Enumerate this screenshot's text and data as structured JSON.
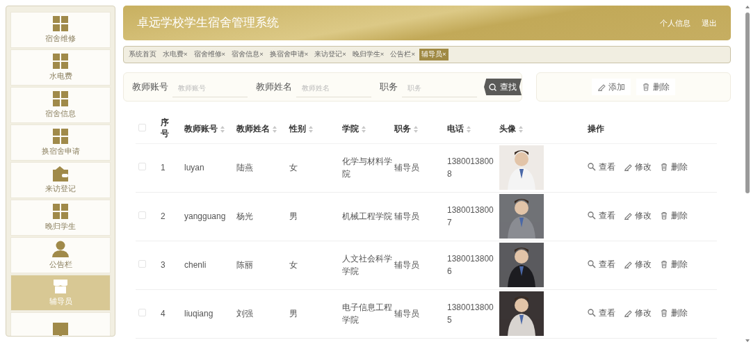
{
  "sidebar": {
    "items": [
      {
        "kind": "grid",
        "label": "宿舍维修",
        "selected": false
      },
      {
        "kind": "grid",
        "label": "水电费",
        "selected": false
      },
      {
        "kind": "grid",
        "label": "宿舍信息",
        "selected": false
      },
      {
        "kind": "grid",
        "label": "换宿舍申请",
        "selected": false
      },
      {
        "kind": "wallet",
        "label": "来访登记",
        "selected": false
      },
      {
        "kind": "grid",
        "label": "晚归学生",
        "selected": false
      },
      {
        "kind": "person",
        "label": "公告栏",
        "selected": false
      },
      {
        "kind": "store",
        "label": "辅导员",
        "selected": true
      },
      {
        "kind": "monitor",
        "selected": false
      }
    ]
  },
  "header": {
    "title": "卓远学校学生宿舍管理系统",
    "links": [
      "个人信息",
      "退出"
    ]
  },
  "tabs": [
    {
      "label": "系统首页",
      "selected": false
    },
    {
      "label": "水电费",
      "close": "×",
      "selected": false
    },
    {
      "label": "宿舍维修",
      "close": "×",
      "selected": false
    },
    {
      "label": "宿舍信息",
      "close": "×",
      "selected": false
    },
    {
      "label": "换宿舍申请",
      "close": "×",
      "selected": false
    },
    {
      "label": "来访登记",
      "close": "×",
      "selected": false
    },
    {
      "label": "晚归学生",
      "close": "×",
      "selected": false
    },
    {
      "label": "公告栏",
      "close": "×",
      "selected": false
    },
    {
      "label": "辅导员",
      "close": "×",
      "selected": true
    }
  ],
  "search": {
    "fields": [
      {
        "label": "教师账号",
        "placeholder": "教师账号"
      },
      {
        "label": "教师姓名",
        "placeholder": "教师姓名"
      },
      {
        "label": "职务",
        "placeholder": "职务"
      }
    ],
    "button": "查找"
  },
  "actions": [
    {
      "kind": "add",
      "label": "添加"
    },
    {
      "kind": "delete",
      "label": "删除"
    }
  ],
  "table": {
    "select_all_checked": false,
    "columns": [
      {
        "label": "序号",
        "sortable": false
      },
      {
        "label": "教师账号",
        "sortable": true
      },
      {
        "label": "教师姓名",
        "sortable": true
      },
      {
        "label": "性别",
        "sortable": true
      },
      {
        "label": "学院",
        "sortable": true
      },
      {
        "label": "职务",
        "sortable": true
      },
      {
        "label": "电话",
        "sortable": true
      },
      {
        "label": "头像",
        "sortable": true
      },
      {
        "label": "操作",
        "sortable": false
      }
    ],
    "rows": [
      {
        "checked": false,
        "cells": [
          "1",
          "luyan",
          "陆燕",
          "女",
          "化学与材料学院",
          "辅导员",
          "13800138008"
        ],
        "avatar": {
          "kind": "picture"
        },
        "operations": [
          {
            "kind": "view",
            "label": "查看"
          },
          {
            "kind": "edit",
            "label": "修改"
          },
          {
            "kind": "delete",
            "label": "删除"
          }
        ]
      },
      {
        "checked": false,
        "cells": [
          "2",
          "yangguang",
          "杨光",
          "男",
          "机械工程学院",
          "辅导员",
          "13800138007"
        ],
        "avatar": {
          "kind": "picture"
        },
        "operations": [
          {
            "kind": "view",
            "label": "查看"
          },
          {
            "kind": "edit",
            "label": "修改"
          },
          {
            "kind": "delete",
            "label": "删除"
          }
        ]
      },
      {
        "checked": false,
        "cells": [
          "3",
          "chenli",
          "陈丽",
          "女",
          "人文社会科学学院",
          "辅导员",
          "13800138006"
        ],
        "avatar": {
          "kind": "picture"
        },
        "operations": [
          {
            "kind": "view",
            "label": "查看"
          },
          {
            "kind": "edit",
            "label": "修改"
          },
          {
            "kind": "delete",
            "label": "删除"
          }
        ]
      },
      {
        "checked": false,
        "cells": [
          "4",
          "liuqiang",
          "刘强",
          "男",
          "电子信息工程学院",
          "辅导员",
          "13800138005"
        ],
        "avatar": {
          "kind": "picture"
        },
        "operations": [
          {
            "kind": "view",
            "label": "查看"
          },
          {
            "kind": "edit",
            "label": "修改"
          },
          {
            "kind": "delete",
            "label": "删除"
          }
        ]
      }
    ]
  }
}
